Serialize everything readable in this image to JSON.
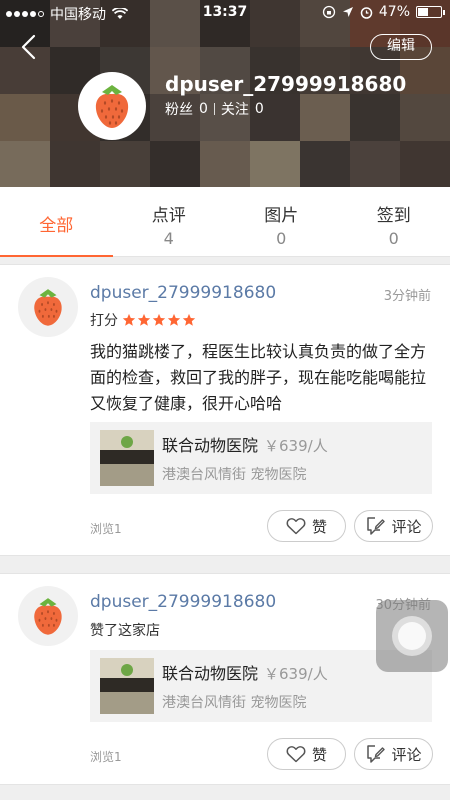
{
  "status_bar": {
    "carrier": "中国移动",
    "time": "13:37",
    "battery": "47%",
    "battery_level": 0.47
  },
  "header": {
    "edit_label": "编辑",
    "username": "dpuser_27999918680",
    "fans_label": "粉丝",
    "fans_count": "0",
    "follow_label": "关注",
    "follow_count": "0",
    "avatar_icon": "strawberry-icon"
  },
  "tabs": [
    {
      "label": "全部",
      "count": ""
    },
    {
      "label": "点评",
      "count": "4"
    },
    {
      "label": "图片",
      "count": "0"
    },
    {
      "label": "签到",
      "count": "0"
    }
  ],
  "feed": [
    {
      "username": "dpuser_27999918680",
      "time": "3分钟前",
      "rating_label": "打分",
      "stars": 5,
      "text": "我的猫跳楼了，程医生比较认真负责的做了全方面的检查，救回了我的胖子，现在能吃能喝能拉又恢复了健康，很开心哈哈",
      "shop_name": "联合动物医院",
      "shop_price": "￥639/人",
      "shop_address": "港澳台风情街 宠物医院",
      "views": "浏览1",
      "like_label": "赞",
      "comment_label": "评论"
    },
    {
      "username": "dpuser_27999918680",
      "time": "30分钟前",
      "action": "赞了这家店",
      "shop_name": "联合动物医院",
      "shop_price": "￥639/人",
      "shop_address": "港澳台风情街 宠物医院",
      "views": "浏览1",
      "like_label": "赞",
      "comment_label": "评论"
    }
  ],
  "colors": {
    "accent": "#ff6633",
    "username_link": "#5b7aa6",
    "star": "#ff6633"
  }
}
